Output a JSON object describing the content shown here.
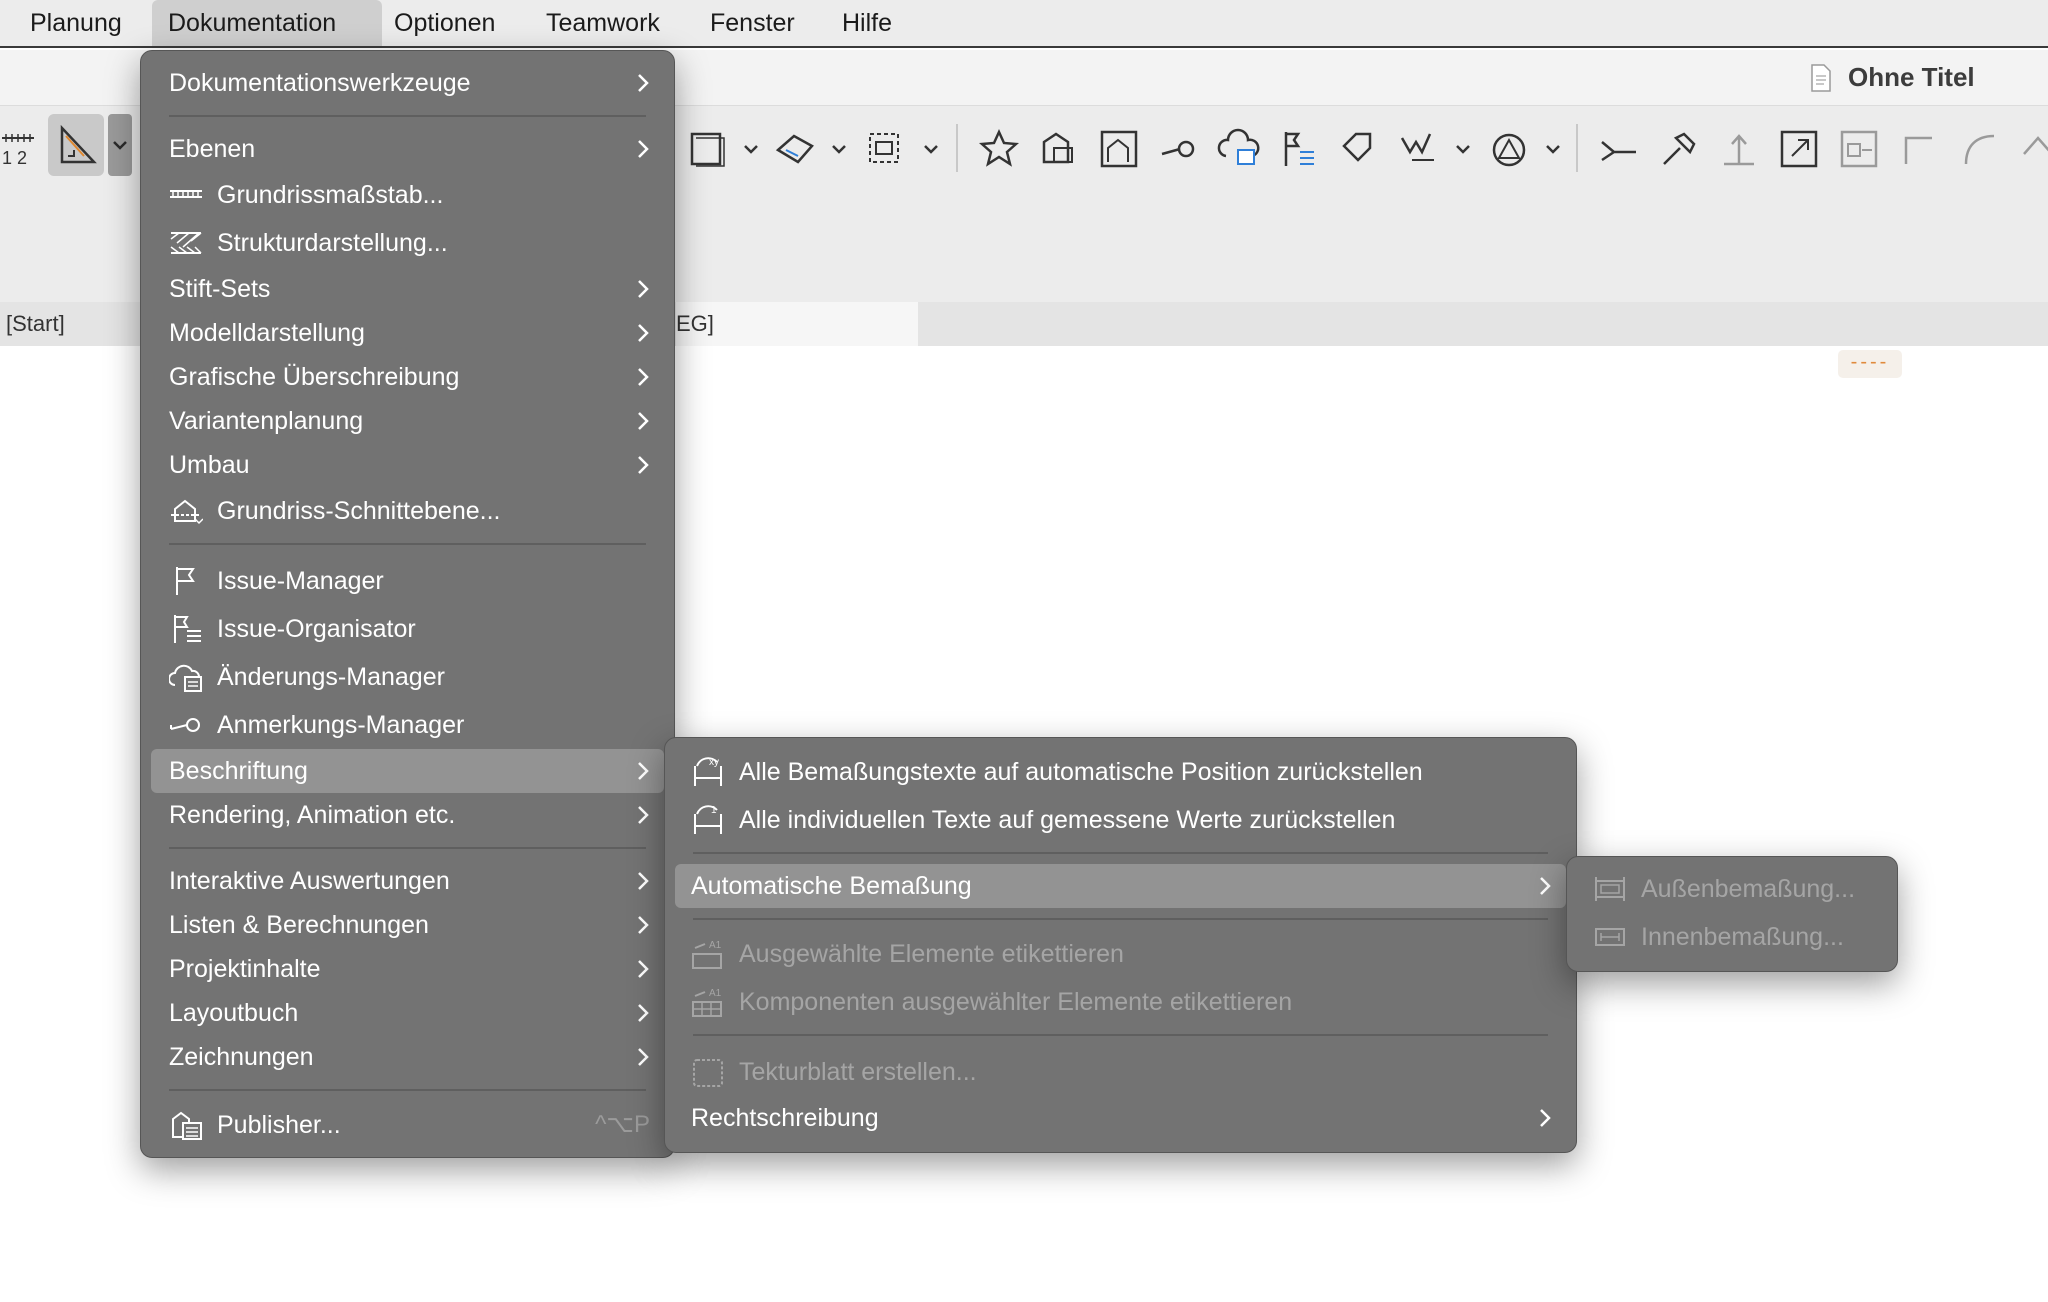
{
  "menubar": {
    "items": [
      "Planung",
      "Dokumentation",
      "Optionen",
      "Teamwork",
      "Fenster",
      "Hilfe"
    ],
    "active": "Dokumentation"
  },
  "window": {
    "title": "Ohne Titel"
  },
  "toolbar": {
    "left_label": "1 2",
    "icons": [
      "slab-icon",
      "roof-icon",
      "mesh-icon",
      "favorites-star-icon",
      "publisher-icon",
      "model-view-icon",
      "annotation-manager-icon",
      "change-manager-icon",
      "issue-organizer-icon",
      "label-icon",
      "magic-wand-icon",
      "shell-icon",
      "split-icon",
      "adjust-icon",
      "elevation-icon",
      "resize-icon",
      "offset-icon",
      "fillet-icon",
      "curve-icon",
      "roof-edge-icon"
    ]
  },
  "tabs": {
    "start": "[Start]",
    "eg": "EG]"
  },
  "status_mark": "----",
  "documentation_menu": {
    "items": [
      {
        "label": "Dokumentationswerkzeuge",
        "submenu": true
      },
      {
        "label": "Ebenen",
        "submenu": true
      },
      {
        "label": "Grundrissmaßstab...",
        "icon": "scale-ruler-icon"
      },
      {
        "label": "Strukturdarstellung...",
        "icon": "hatch-structure-icon"
      },
      {
        "label": "Stift-Sets",
        "submenu": true
      },
      {
        "label": "Modelldarstellung",
        "submenu": true
      },
      {
        "label": "Grafische Überschreibung",
        "submenu": true
      },
      {
        "label": "Variantenplanung",
        "submenu": true
      },
      {
        "label": "Umbau",
        "submenu": true
      },
      {
        "label": "Grundriss-Schnittebene...",
        "icon": "floor-plan-cut-plane-icon"
      },
      {
        "label": "Issue-Manager",
        "icon": "flag-icon"
      },
      {
        "label": "Issue-Organisator",
        "icon": "issue-organizer-icon"
      },
      {
        "label": "Änderungs-Manager",
        "icon": "change-cloud-icon"
      },
      {
        "label": "Anmerkungs-Manager",
        "icon": "annotation-manager-icon"
      },
      {
        "label": "Beschriftung",
        "submenu": true,
        "highlighted": true
      },
      {
        "label": "Rendering, Animation etc.",
        "submenu": true
      },
      {
        "label": "Interaktive Auswertungen",
        "submenu": true
      },
      {
        "label": "Listen & Berechnungen",
        "submenu": true
      },
      {
        "label": "Projektinhalte",
        "submenu": true
      },
      {
        "label": "Layoutbuch",
        "submenu": true
      },
      {
        "label": "Zeichnungen",
        "submenu": true
      },
      {
        "label": "Publisher...",
        "icon": "publisher-icon",
        "shortcut": "^⌥P"
      }
    ]
  },
  "beschriftung_menu": {
    "items": [
      {
        "label": "Alle Bemaßungstexte auf automatische Position zurückstellen",
        "icon": "reset-dimension-text-position-icon"
      },
      {
        "label": "Alle individuellen Texte auf gemessene Werte zurückstellen",
        "icon": "reset-dimension-values-icon"
      },
      {
        "label": "Automatische Bemaßung",
        "submenu": true,
        "highlighted": true
      },
      {
        "label": "Ausgewählte Elemente etikettieren",
        "icon": "label-elements-icon",
        "disabled": true
      },
      {
        "label": "Komponenten ausgewählter Elemente etikettieren",
        "icon": "label-components-icon",
        "disabled": true
      },
      {
        "label": "Tekturblatt erstellen...",
        "icon": "change-sheet-icon",
        "disabled": true
      },
      {
        "label": "Rechtschreibung",
        "submenu": true
      }
    ]
  },
  "auto_dimension_menu": {
    "items": [
      {
        "label": "Außenbemaßung...",
        "icon": "exterior-dimension-icon",
        "disabled": true
      },
      {
        "label": "Innenbemaßung...",
        "icon": "interior-dimension-icon",
        "disabled": true
      }
    ]
  }
}
